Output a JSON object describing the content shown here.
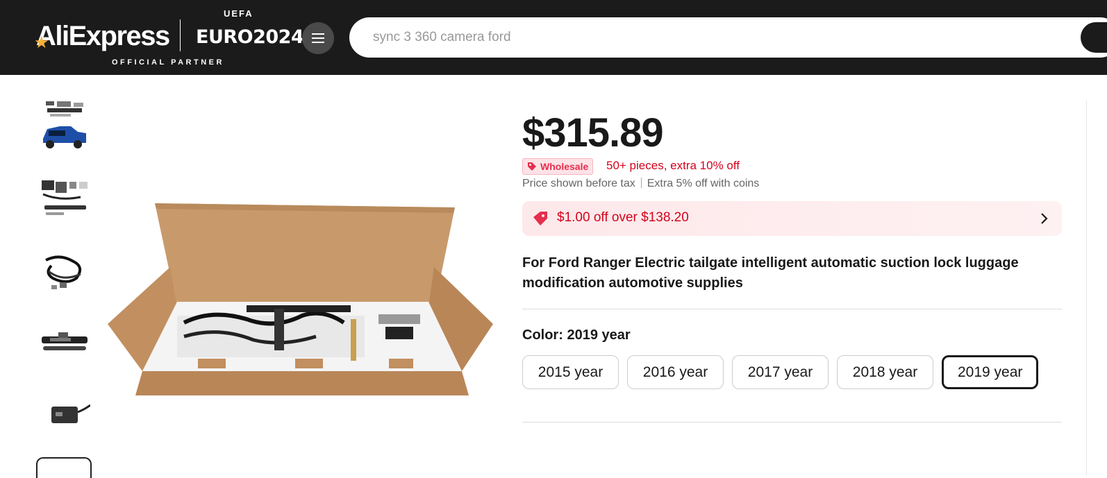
{
  "header": {
    "logo_text": "AliExpress",
    "partner_logo": "EURO2024",
    "partner_logo_top": "UEFA",
    "partner_subtitle": "OFFICIAL PARTNER",
    "search_placeholder": "sync 3 360 camera ford"
  },
  "gallery": {
    "thumbnails": [
      "product-thumb-truck",
      "product-thumb-kit",
      "product-thumb-wiring",
      "product-thumb-handle",
      "product-thumb-module"
    ]
  },
  "product": {
    "price": "$315.89",
    "wholesale_label": "Wholesale",
    "wholesale_offer": "50+ pieces, extra 10% off",
    "tax_note": "Price shown before tax",
    "coins_note": "Extra 5% off with coins",
    "coupon_text": "$1.00 off over $138.20",
    "title": "For Ford Ranger Electric tailgate intelligent automatic suction lock luggage modification automotive supplies",
    "color_label": "Color:",
    "color_selected": "2019 year",
    "color_options": [
      "2015 year",
      "2016 year",
      "2017 year",
      "2018 year",
      "2019 year"
    ]
  },
  "colors": {
    "header_bg": "#1b1b1b",
    "accent_red": "#d3031c",
    "text": "#191919"
  }
}
